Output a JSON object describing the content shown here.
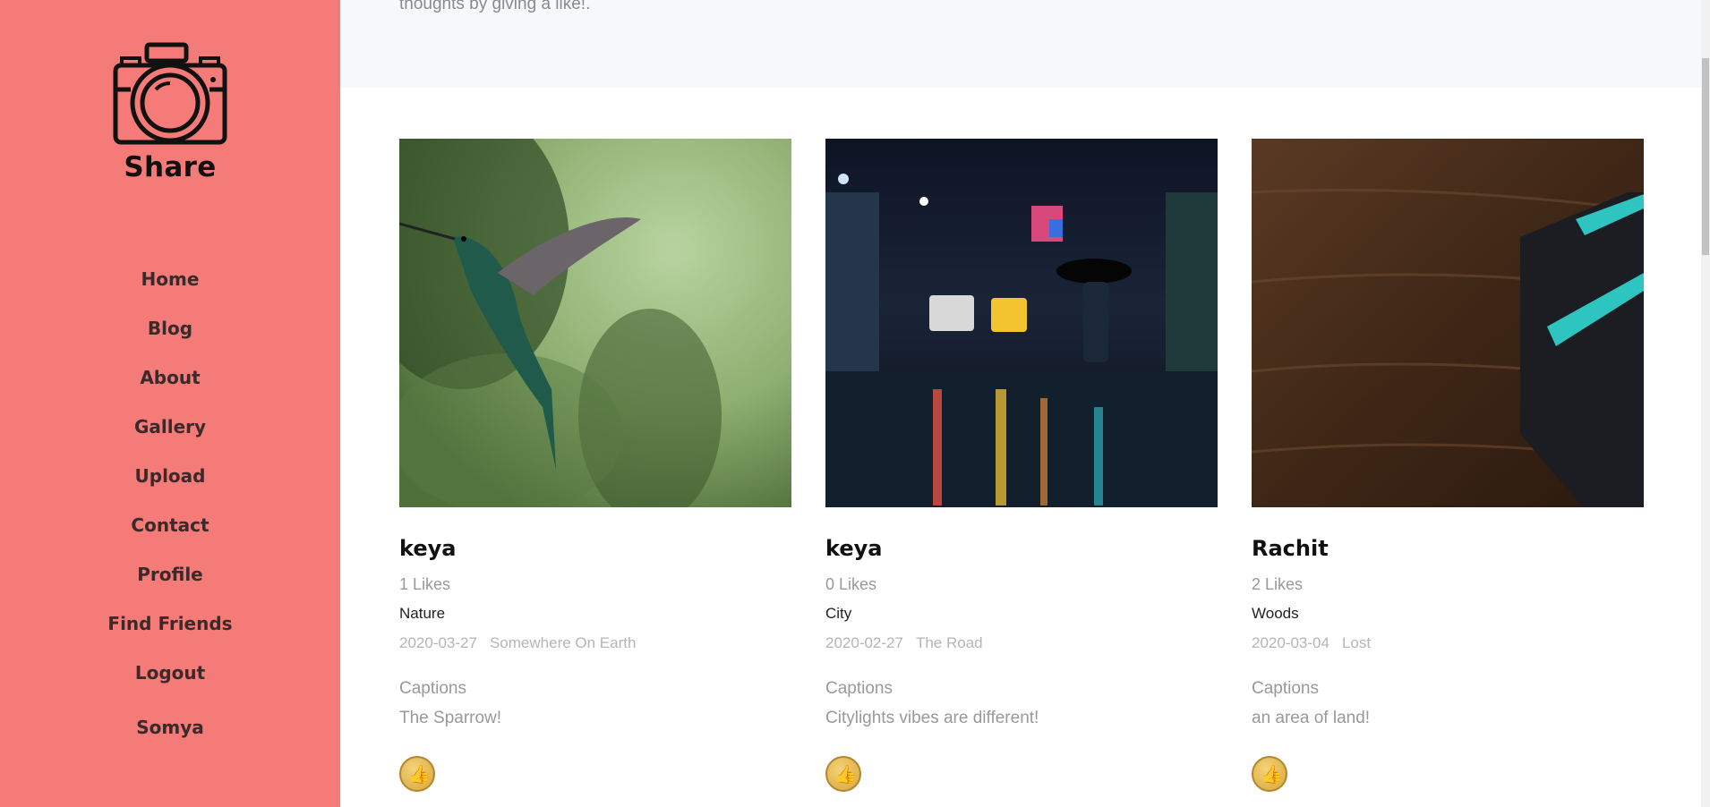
{
  "sidebar": {
    "brand": "Share",
    "nav": [
      "Home",
      "Blog",
      "About",
      "Gallery",
      "Upload",
      "Contact",
      "Profile",
      "Find Friends",
      "Logout"
    ],
    "user": "Somya",
    "background": "#f47b78"
  },
  "hero": {
    "text": "thoughts by giving a like!."
  },
  "posts": [
    {
      "author": "keya",
      "likes": "1 Likes",
      "category": "Nature",
      "date": "2020-03-27",
      "location": "Somewhere On Earth",
      "captions_label": "Captions",
      "caption": "The Sparrow!",
      "image": "hummingbird-photo"
    },
    {
      "author": "keya",
      "likes": "0 Likes",
      "category": "City",
      "date": "2020-02-27",
      "location": "The Road",
      "captions_label": "Captions",
      "caption": "Citylights vibes are different!",
      "image": "rainy-city-street-photo"
    },
    {
      "author": "Rachit",
      "likes": "2 Likes",
      "category": "Woods",
      "date": "2020-03-04",
      "location": "Lost",
      "captions_label": "Captions",
      "caption": "an area of land!",
      "image": "gift-box-on-wood-photo"
    }
  ]
}
